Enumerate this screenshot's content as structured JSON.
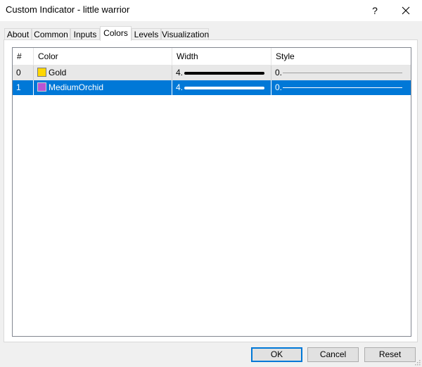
{
  "window": {
    "title": "Custom Indicator - little warrior",
    "help_label": "?"
  },
  "tabs": [
    {
      "label": "About"
    },
    {
      "label": "Common"
    },
    {
      "label": "Inputs"
    },
    {
      "label": "Colors",
      "active": true
    },
    {
      "label": "Levels"
    },
    {
      "label": "Visualization"
    }
  ],
  "grid": {
    "columns": [
      "#",
      "Color",
      "Width",
      "Style"
    ],
    "rows": [
      {
        "index": "0",
        "color_name": "Gold",
        "color_hex": "#ffd700",
        "width": "4.",
        "width_line_color": "#000000",
        "style": "0.",
        "style_line_color": "#a0a0a0",
        "selected": false
      },
      {
        "index": "1",
        "color_name": "MediumOrchid",
        "color_hex": "#ba55d3",
        "width": "4.",
        "width_line_color": "#ffffff",
        "style": "0.",
        "style_line_color": "#ffffff",
        "selected": true
      }
    ]
  },
  "buttons": {
    "ok": "OK",
    "cancel": "Cancel",
    "reset": "Reset"
  },
  "colors": {
    "selection": "#0078d7",
    "default_button_border": "#0078d7"
  }
}
